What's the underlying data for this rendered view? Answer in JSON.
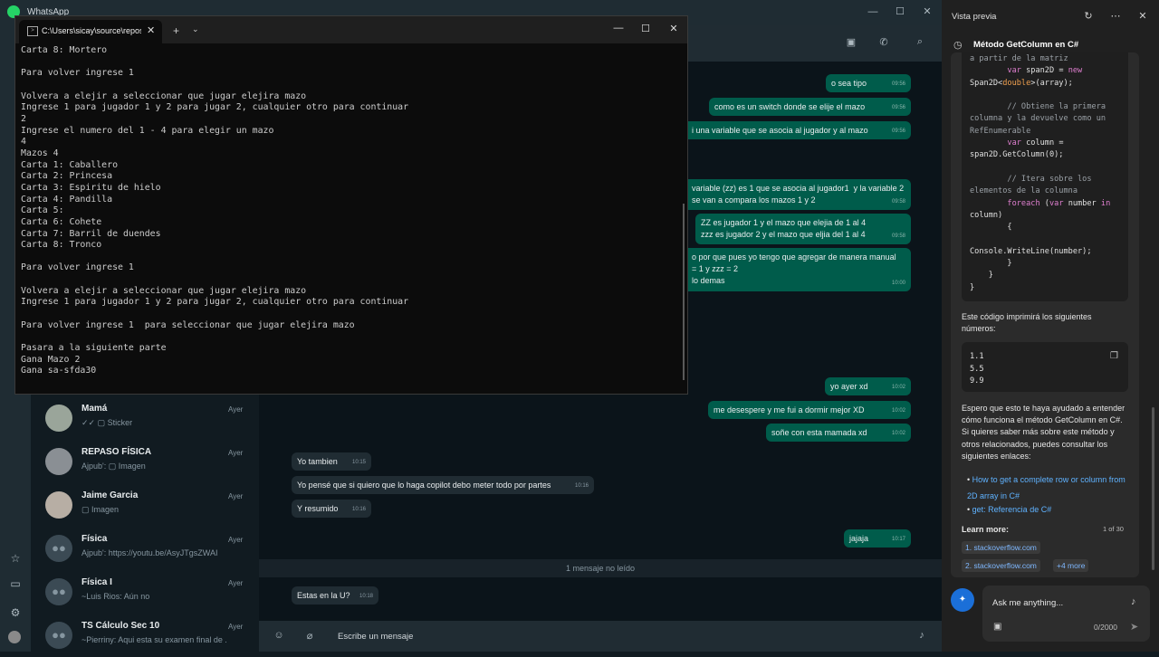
{
  "whatsapp": {
    "title": "WhatsApp",
    "window_controls": [
      "—",
      "☐",
      "✕"
    ],
    "chats": [
      {
        "name": "Mamá",
        "preview": "✓✓ ▢ Sticker",
        "time": "Ayer"
      },
      {
        "name": "REPASO FÍSICA",
        "preview": "Ajpub': ▢ Imagen",
        "time": "Ayer"
      },
      {
        "name": "Jaime Garcia",
        "preview": "▢ Imagen",
        "time": "Ayer"
      },
      {
        "name": "Física",
        "preview": "Ajpub': https://youtu.be/AsyJTgsZWAI",
        "time": "Ayer"
      },
      {
        "name": "Física I",
        "preview": "~Luis Rios: Aún no",
        "time": "Ayer"
      },
      {
        "name": "TS Cálculo Sec 10",
        "preview": "~Pierriny: Aqui esta su examen final de ...",
        "time": "Ayer"
      }
    ],
    "messages": [
      {
        "text": "o sea tipo",
        "time": "09:56",
        "dir": "out"
      },
      {
        "text": "como es un switch donde se elije el mazo",
        "time": "09:56",
        "dir": "out"
      },
      {
        "text": "i una variable que se asocia al jugador y al mazo",
        "time": "09:56",
        "dir": "out"
      },
      {
        "text": "variable (zz) es 1 que se asocia al jugador1  y la variable 2\nse van a compara los mazos 1 y 2",
        "time": "09:58",
        "dir": "out"
      },
      {
        "text": "ZZ es jugador 1 y el mazo que elejia de 1 al 4\nzzz es jugador 2 y el mazo que eljia del 1 al 4",
        "time": "09:58",
        "dir": "out"
      },
      {
        "text": "o por que pues yo tengo que agregar de manera manual\n= 1 y zzz = 2\nlo demas",
        "time": "10:00",
        "dir": "out"
      },
      {
        "text": "yo ayer xd",
        "time": "10:02",
        "dir": "out"
      },
      {
        "text": "me desespere y me fui a dormir mejor XD",
        "time": "10:02",
        "dir": "out"
      },
      {
        "text": "soñe con esta mamada xd",
        "time": "10:02",
        "dir": "out"
      },
      {
        "text": "Yo tambien",
        "time": "10:15",
        "dir": "in"
      },
      {
        "text": "Yo pensé que si quiero que lo haga copilot debo meter todo por partes",
        "time": "10:16",
        "dir": "in"
      },
      {
        "text": "Y resumido",
        "time": "10:16",
        "dir": "in"
      },
      {
        "text": "jajaja",
        "time": "10:17",
        "dir": "out"
      },
      {
        "text": "Estas en la U?",
        "time": "10:18",
        "dir": "in"
      }
    ],
    "unread_divider": "1 mensaje no leído",
    "composer_placeholder": "Escribe un mensaje"
  },
  "terminal": {
    "tab_title": "C:\\Users\\sicay\\source\\repos\\",
    "lines": "Carta 8: Mortero\n\nPara volver ingrese 1\n\nVolvera a elejir a seleccionar que jugar elejira mazo\nIngrese 1 para jugador 1 y 2 para jugar 2, cualquier otro para continuar\n2\nIngrese el numero del 1 - 4 para elegir un mazo\n4\nMazos 4\nCarta 1: Caballero\nCarta 2: Princesa\nCarta 3: Espiritu de hielo\nCarta 4: Pandilla\nCarta 5:\nCarta 6: Cohete\nCarta 7: Barril de duendes\nCarta 8: Tronco\n\nPara volver ingrese 1\n\nVolvera a elejir a seleccionar que jugar elejira mazo\nIngrese 1 para jugador 1 y 2 para jugar 2, cualquier otro para continuar\n\nPara volver ingrese 1  para seleccionar que jugar elejira mazo\n\nPasara a la siguiente parte\nGana Mazo 2\nGana sa-sfda30"
  },
  "copilot": {
    "panel_title": "Vista previa",
    "heading": "Método GetColumn en C#",
    "code_lines": [
      {
        "t": "a partir de la matriz",
        "c": "cm"
      },
      {
        "t": "        var span2D = new",
        "c": "code"
      },
      {
        "t": "Span2D<double>(array);",
        "c": "code"
      },
      {
        "t": "",
        "c": "code"
      },
      {
        "t": "        // Obtiene la primera",
        "c": "cm"
      },
      {
        "t": "columna y la devuelve como un",
        "c": "cm"
      },
      {
        "t": "RefEnumerable",
        "c": "cm"
      },
      {
        "t": "        var column =",
        "c": "code"
      },
      {
        "t": "span2D.GetColumn(0);",
        "c": "code"
      },
      {
        "t": "",
        "c": "code"
      },
      {
        "t": "        // Itera sobre los",
        "c": "cm"
      },
      {
        "t": "elementos de la columna",
        "c": "cm"
      },
      {
        "t": "        foreach (var number in",
        "c": "code"
      },
      {
        "t": "column)",
        "c": "code"
      },
      {
        "t": "        {",
        "c": "code"
      },
      {
        "t": "",
        "c": "code"
      },
      {
        "t": "Console.WriteLine(number);",
        "c": "code"
      },
      {
        "t": "        }",
        "c": "code"
      },
      {
        "t": "    }",
        "c": "code"
      },
      {
        "t": "}",
        "c": "code"
      }
    ],
    "para1": "Este código imprimirá los siguientes números:",
    "output": "1.1\n5.5\n9.9",
    "para2": "Espero que esto te haya ayudado a entender cómo funciona el método GetColumn en C#. Si quieres saber más sobre este método y otros relacionados, puedes consultar los siguientes enlaces:",
    "links": [
      "How to get a complete row or column from 2D array in C#",
      "get: Referencia de C#"
    ],
    "learn_more": "Learn more:",
    "count": "1 of 30",
    "chips": [
      "1. stackoverflow.com",
      "2. stackoverflow.com",
      "+4 more"
    ],
    "ask_placeholder": "Ask me anything...",
    "char_counter": "0/2000"
  }
}
